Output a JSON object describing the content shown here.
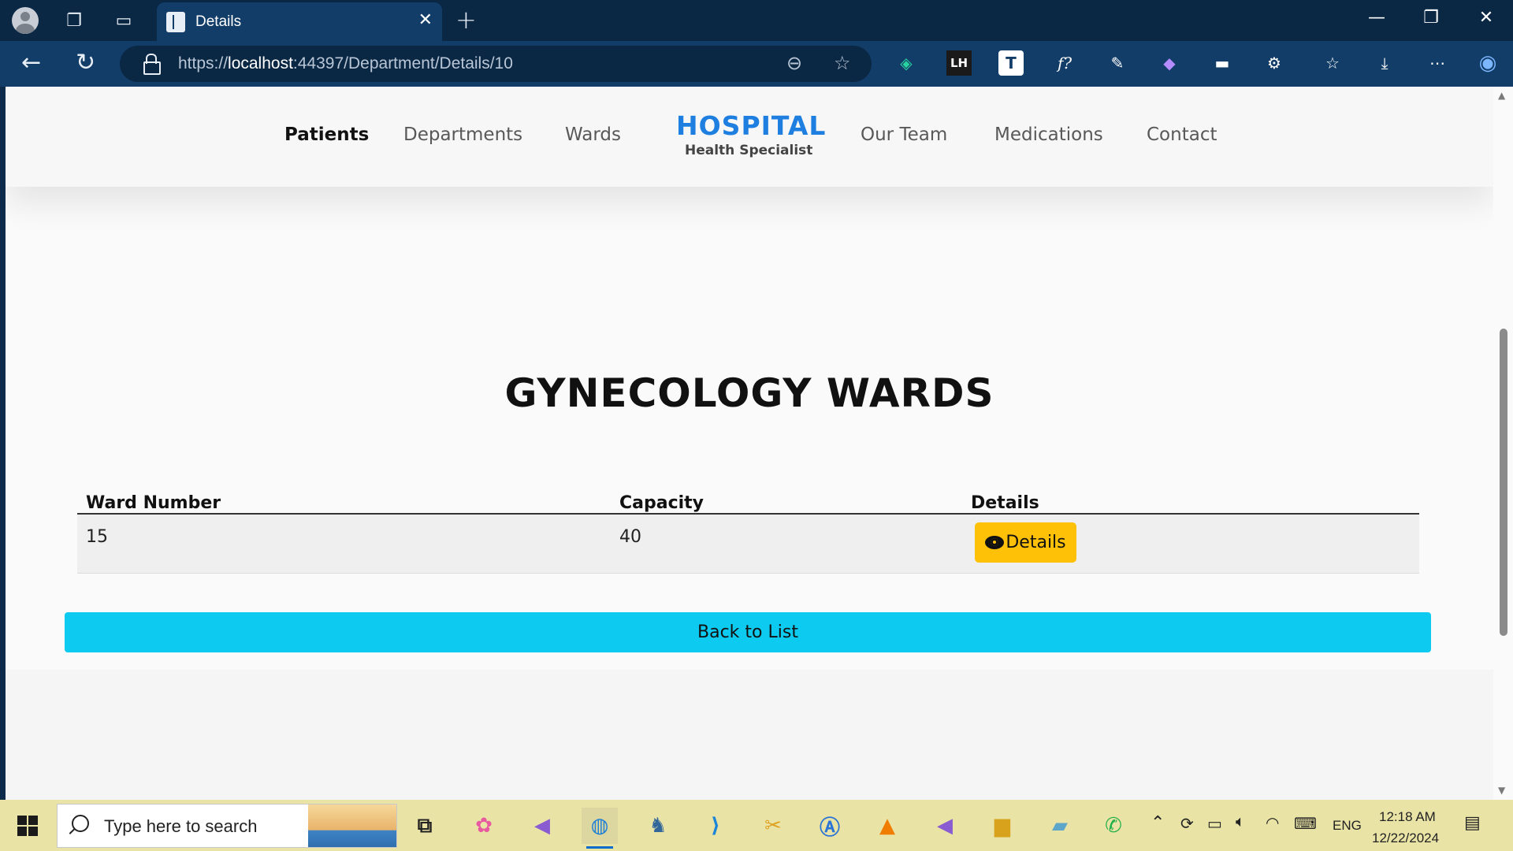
{
  "browser": {
    "tab_title": "Details",
    "url_scheme": "https://",
    "url_host": "localhost",
    "url_rest": ":44397/Department/Details/10"
  },
  "site": {
    "nav_left": [
      "Patients",
      "Departments",
      "Wards"
    ],
    "brand_title": "HOSPITAL",
    "brand_subtitle": "Health Specialist",
    "nav_right": [
      "Our Team",
      "Medications",
      "Contact"
    ],
    "active_nav": "Patients"
  },
  "page": {
    "title": "GYNECOLOGY WARDS",
    "table": {
      "headers": [
        "Ward Number",
        "Capacity",
        "Details"
      ],
      "rows": [
        {
          "ward_number": "15",
          "capacity": "40",
          "action": "Details"
        }
      ]
    },
    "back_label": "Back to List"
  },
  "taskbar": {
    "search_placeholder": "Type here to search",
    "language": "ENG",
    "time": "12:18 AM",
    "date": "12/22/2024"
  },
  "colors": {
    "brand": "#1f7fe0",
    "details_button": "#ffc107",
    "back_button": "#0dcaf0",
    "browser_tabbar": "#0a2744",
    "taskbar": "#e9e3a6"
  }
}
